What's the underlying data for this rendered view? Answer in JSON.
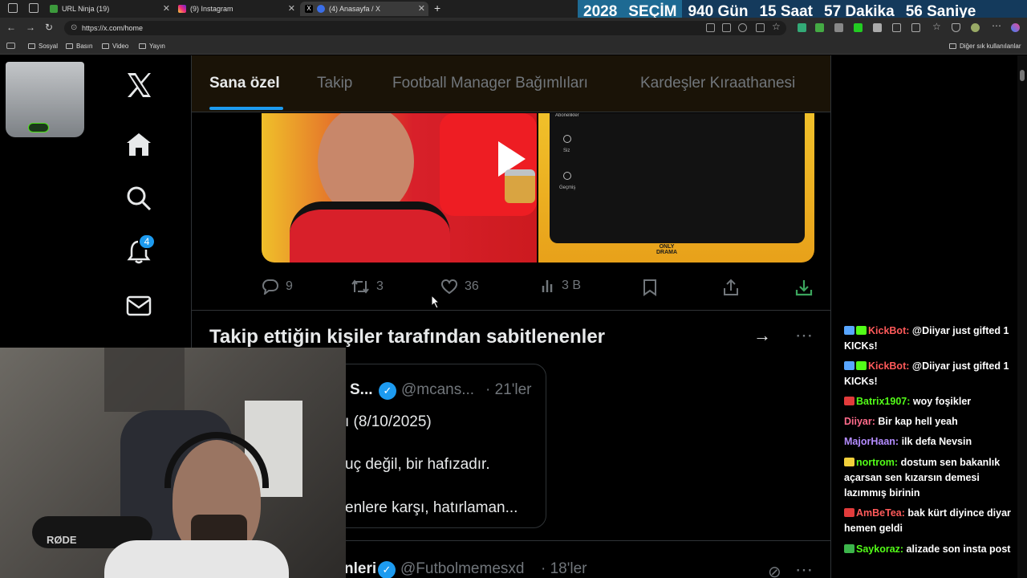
{
  "browser": {
    "tabs": [
      {
        "label": "URL Ninja (19)"
      },
      {
        "label": "(9) Instagram"
      },
      {
        "label": "(4) Anasayfa / X"
      }
    ],
    "new_tab": "+",
    "url": "https://x.com/home",
    "bookmarks": [
      "Sosyal",
      "Basın",
      "Video",
      "Yayın"
    ],
    "other_bookmarks": "Diğer sık kullanılanlar"
  },
  "countdown": [
    "2028",
    "SEÇİM",
    "940 Gün",
    "15 Saat",
    "57 Dakika",
    "56 Saniye"
  ],
  "leftnav": {
    "notification_count": "4"
  },
  "main": {
    "tabs": [
      "Sana özel",
      "Takip",
      "Football Manager Bağımlıları",
      "Kardeşler Kıraathanesi"
    ],
    "media_labels": {
      "subscriptions": "Abonelikler",
      "you": "Siz",
      "history": "Geçmiş",
      "logo": "ONLY DRAMA"
    },
    "actions": {
      "replies": "9",
      "reposts": "3",
      "likes": "36",
      "views": "3 B"
    },
    "pinned_title": "Takip ettiğin kişiler tarafından sabitlenenler",
    "pinned_card": {
      "name": "S...",
      "handle": "@mcans...",
      "time": "· 21'ler",
      "line1": "ı (8/10/2025)",
      "line2": "uç değil, bir hafızadır.",
      "line3": "enlere karşı, hatırlaman..."
    },
    "next_post": {
      "name": "nleri",
      "handle": "@Futbolmemesxd",
      "time": "· 18'ler"
    }
  },
  "chat": [
    {
      "user": "KickBot:",
      "msg": "@Diiyar just gifted 1 KICKs!",
      "color": "#ff5a5a",
      "emo": [
        "#58a6ff",
        "#53fc18"
      ]
    },
    {
      "user": "KickBot:",
      "msg": "@Diiyar just gifted 1 KICKs!",
      "color": "#ff5a5a",
      "emo": [
        "#58a6ff",
        "#53fc18"
      ]
    },
    {
      "user": "Batrix1907:",
      "msg": "woy foşikler",
      "color": "#53fc18",
      "emo": [
        "#e23b3b"
      ]
    },
    {
      "user": "Diiyar:",
      "msg": "Bir kap hell yeah",
      "color": "#ff6b8b",
      "emo": []
    },
    {
      "user": "MajorHaan:",
      "msg": "ilk defa Nevsin",
      "color": "#b48cff",
      "emo": []
    },
    {
      "user": "nortrom:",
      "msg": "dostum sen bakanlık açarsan sen kızarsın demesi lazımmış birinin",
      "color": "#53fc18",
      "emo": [
        "#f2d03b"
      ]
    },
    {
      "user": "AmBeTea:",
      "msg": "bak kürt diyince diyar hemen geldi",
      "color": "#ff5a5a",
      "emo": [
        "#e23b3b"
      ]
    },
    {
      "user": "Saykoraz:",
      "msg": "alizade son insta post",
      "color": "#53fc18",
      "emo": [
        "#3cb44b"
      ]
    }
  ],
  "colors": {
    "accent": "#1d9bf0",
    "kick_green": "#53fc18"
  }
}
